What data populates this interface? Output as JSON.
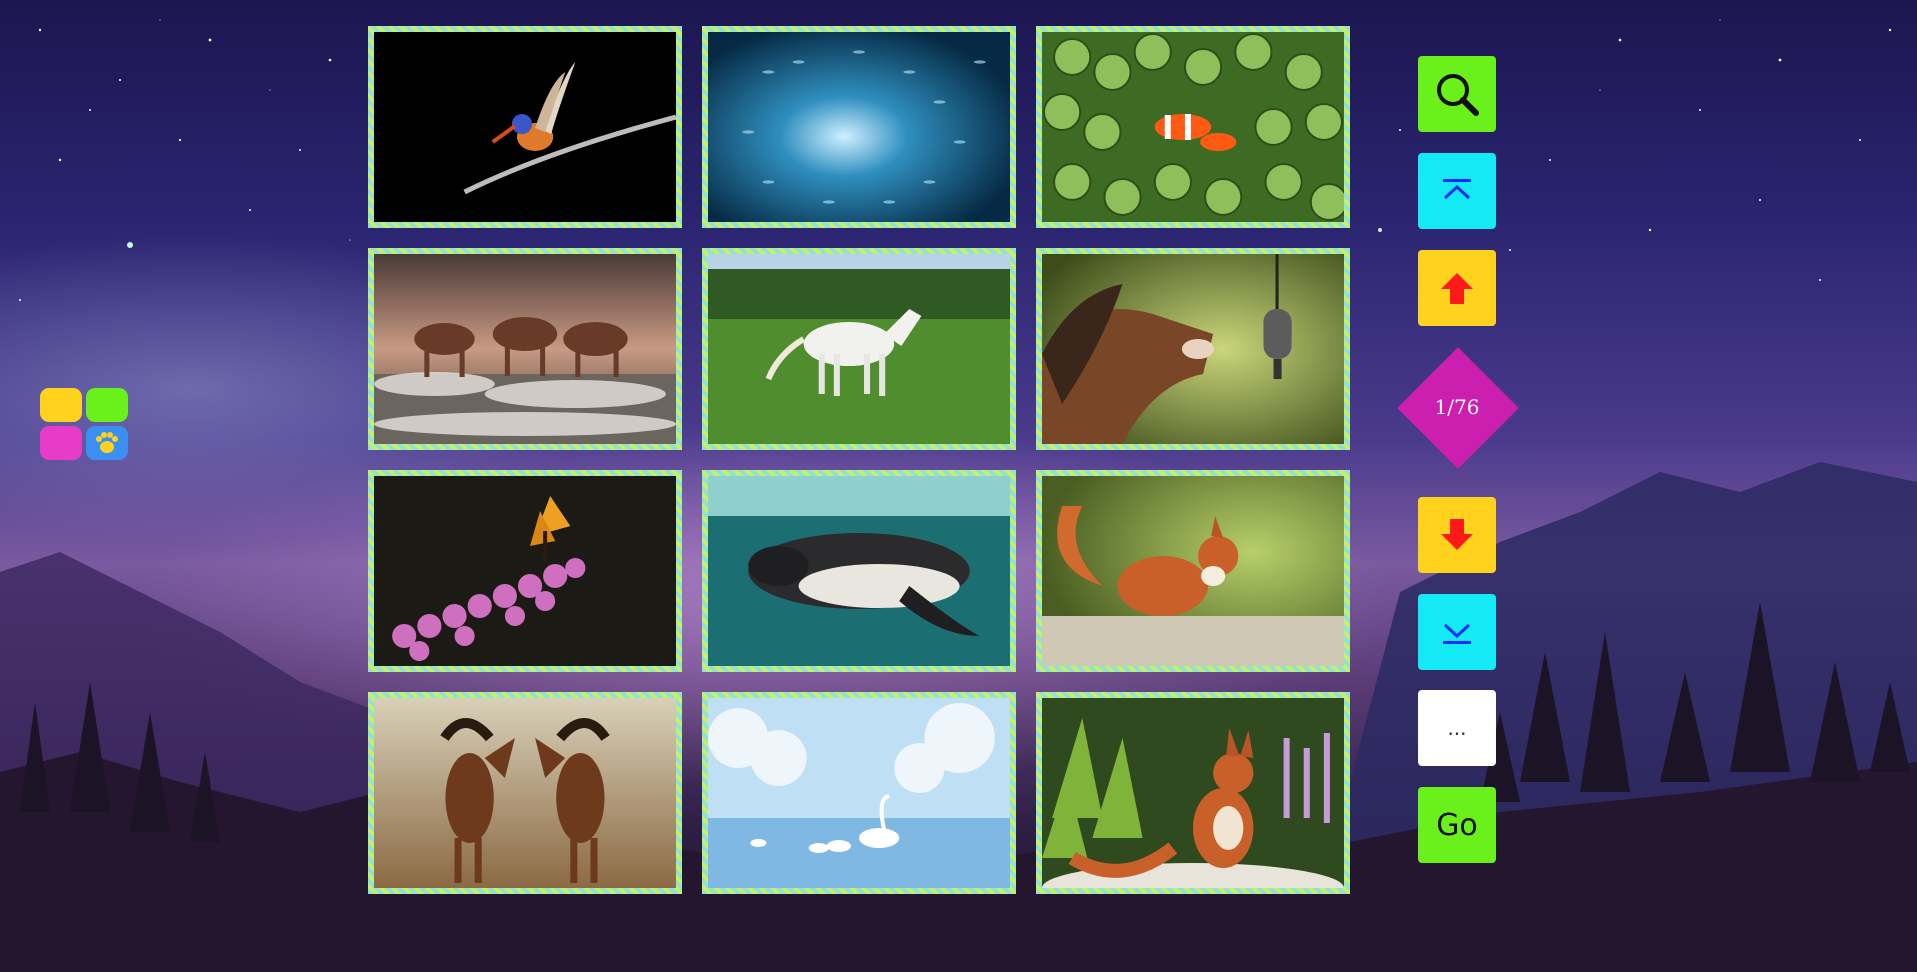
{
  "app": {
    "launcher": {
      "icons": [
        "yellow-tile",
        "green-tile",
        "magenta-tile",
        "paw-icon"
      ],
      "colors": {
        "yellow": "#ffd21e",
        "green": "#6af01b",
        "magenta": "#e73cc7",
        "blue": "#3b8ff0"
      }
    }
  },
  "gallery": {
    "tiles": [
      {
        "subject": "kingfisher-on-branch",
        "icon": "bird"
      },
      {
        "subject": "school-of-fish",
        "icon": "fish"
      },
      {
        "subject": "clownfish-in-anemone",
        "icon": "fish"
      },
      {
        "subject": "horses-running-in-surf",
        "icon": "horse"
      },
      {
        "subject": "white-horse-in-meadow",
        "icon": "horse"
      },
      {
        "subject": "horse-with-microphone",
        "icon": "horse"
      },
      {
        "subject": "butterfly-on-flowers",
        "icon": "butterfly"
      },
      {
        "subject": "penguin-swimming",
        "icon": "penguin"
      },
      {
        "subject": "red-squirrel",
        "icon": "squirrel"
      },
      {
        "subject": "rearing-horses",
        "icon": "horse"
      },
      {
        "subject": "swans-in-winter",
        "icon": "swan"
      },
      {
        "subject": "squirrel-eating",
        "icon": "squirrel"
      }
    ],
    "border_colors": [
      "#8fe3d6",
      "#c6f06a"
    ]
  },
  "sidebar": {
    "search_icon": "search-icon",
    "first_page_icon": "chevron-up-bar-icon",
    "prev_page_icon": "arrow-up-icon",
    "page_counter": "1/76",
    "next_page_icon": "arrow-down-icon",
    "last_page_icon": "chevron-down-bar-icon",
    "more_label": "...",
    "go_label": "Go",
    "colors": {
      "green": "#6af01b",
      "cyan": "#13eaf5",
      "yellow": "#ffd21e",
      "magenta": "#cb1fb0",
      "arrow_red": "#ff1a1a",
      "arrow_blue": "#1a2bff"
    }
  }
}
